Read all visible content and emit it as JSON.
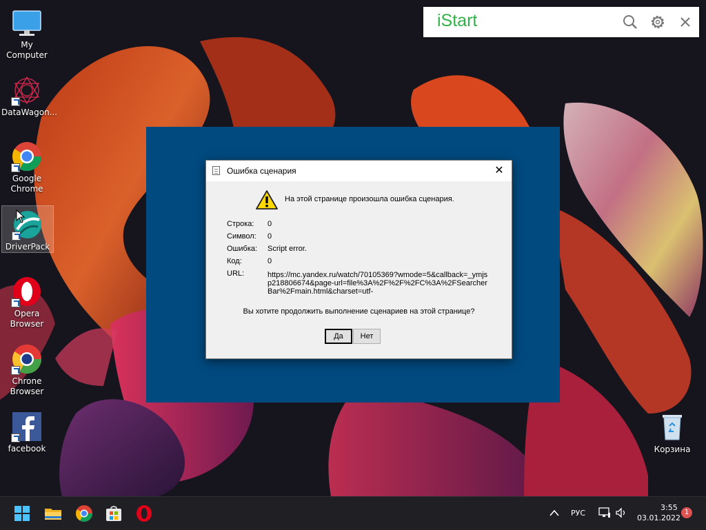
{
  "desktop": {
    "icons": [
      {
        "label": "My Computer",
        "icon": "monitor-icon"
      },
      {
        "label": "DataWagon...",
        "icon": "datawagon-icon"
      },
      {
        "label": "Google Chrome",
        "icon": "chrome-icon"
      },
      {
        "label": "DriverPack",
        "icon": "driverpack-icon"
      },
      {
        "label": "Opera Browser",
        "icon": "opera-icon"
      },
      {
        "label": "Chrone Browser",
        "icon": "chrome-alt-icon"
      },
      {
        "label": "facebook",
        "icon": "facebook-icon"
      }
    ],
    "recycle_bin": {
      "label": "Корзина",
      "icon": "recycle-bin-icon"
    }
  },
  "istart": {
    "brand": "iStart",
    "search_icon": "search-icon",
    "settings_icon": "gear-icon",
    "close_icon": "close-icon",
    "brand_color": "#33b04a"
  },
  "dialog": {
    "title": "Ошибка сценария",
    "close_glyph": "✕",
    "message": "На этой странице произошла ошибка сценария.",
    "rows": [
      {
        "label": "Строка:",
        "value": "0"
      },
      {
        "label": "Символ:",
        "value": "0"
      },
      {
        "label": "Ошибка:",
        "value": "Script error."
      },
      {
        "label": "Код:",
        "value": "0"
      }
    ],
    "url_label": "URL:",
    "url_value": "https://mc.yandex.ru/watch/70105369?wmode=5&callback=_ymjsp218806674&page-url=file%3A%2F%2F%2FC%3A%2FSearcherBar%2Fmain.html&charset=utf-",
    "question": "Вы хотите продолжить выполнение сценариев на этой странице?",
    "yes_button": "Да",
    "no_button": "Нет"
  },
  "taskbar": {
    "apps": [
      "start-icon",
      "file-explorer-icon",
      "chrome-icon",
      "store-icon",
      "opera-icon"
    ],
    "language": "РУС",
    "time": "3:55",
    "date": "03.01.2022",
    "notification_count": "1"
  },
  "colors": {
    "backdrop_blue": "#004a7f",
    "taskbar": "#1f1f24"
  }
}
